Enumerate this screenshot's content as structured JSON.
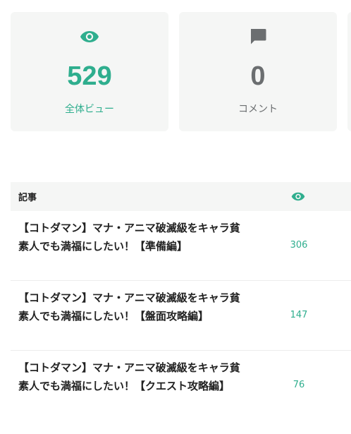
{
  "stats": {
    "views": {
      "icon": "eye-icon",
      "value": "529",
      "label": "全体ビュー"
    },
    "comments": {
      "icon": "comment-icon",
      "value": "0",
      "label": "コメント"
    }
  },
  "table": {
    "header": {
      "title": "記事",
      "views_icon": "eye-icon"
    },
    "rows": [
      {
        "title": "【コトダマン】マナ・アニマ破滅級をキャラ貧素人でも満福にしたい！【準備編】",
        "views": "306"
      },
      {
        "title": "【コトダマン】マナ・アニマ破滅級をキャラ貧素人でも満福にしたい！【盤面攻略編】",
        "views": "147"
      },
      {
        "title": "【コトダマン】マナ・アニマ破滅級をキャラ貧素人でも満福にしたい！【クエスト攻略編】",
        "views": "76"
      }
    ]
  },
  "colors": {
    "accent": "#2fae8e",
    "muted": "#6b6e70",
    "card_bg": "#f5f6f5"
  }
}
